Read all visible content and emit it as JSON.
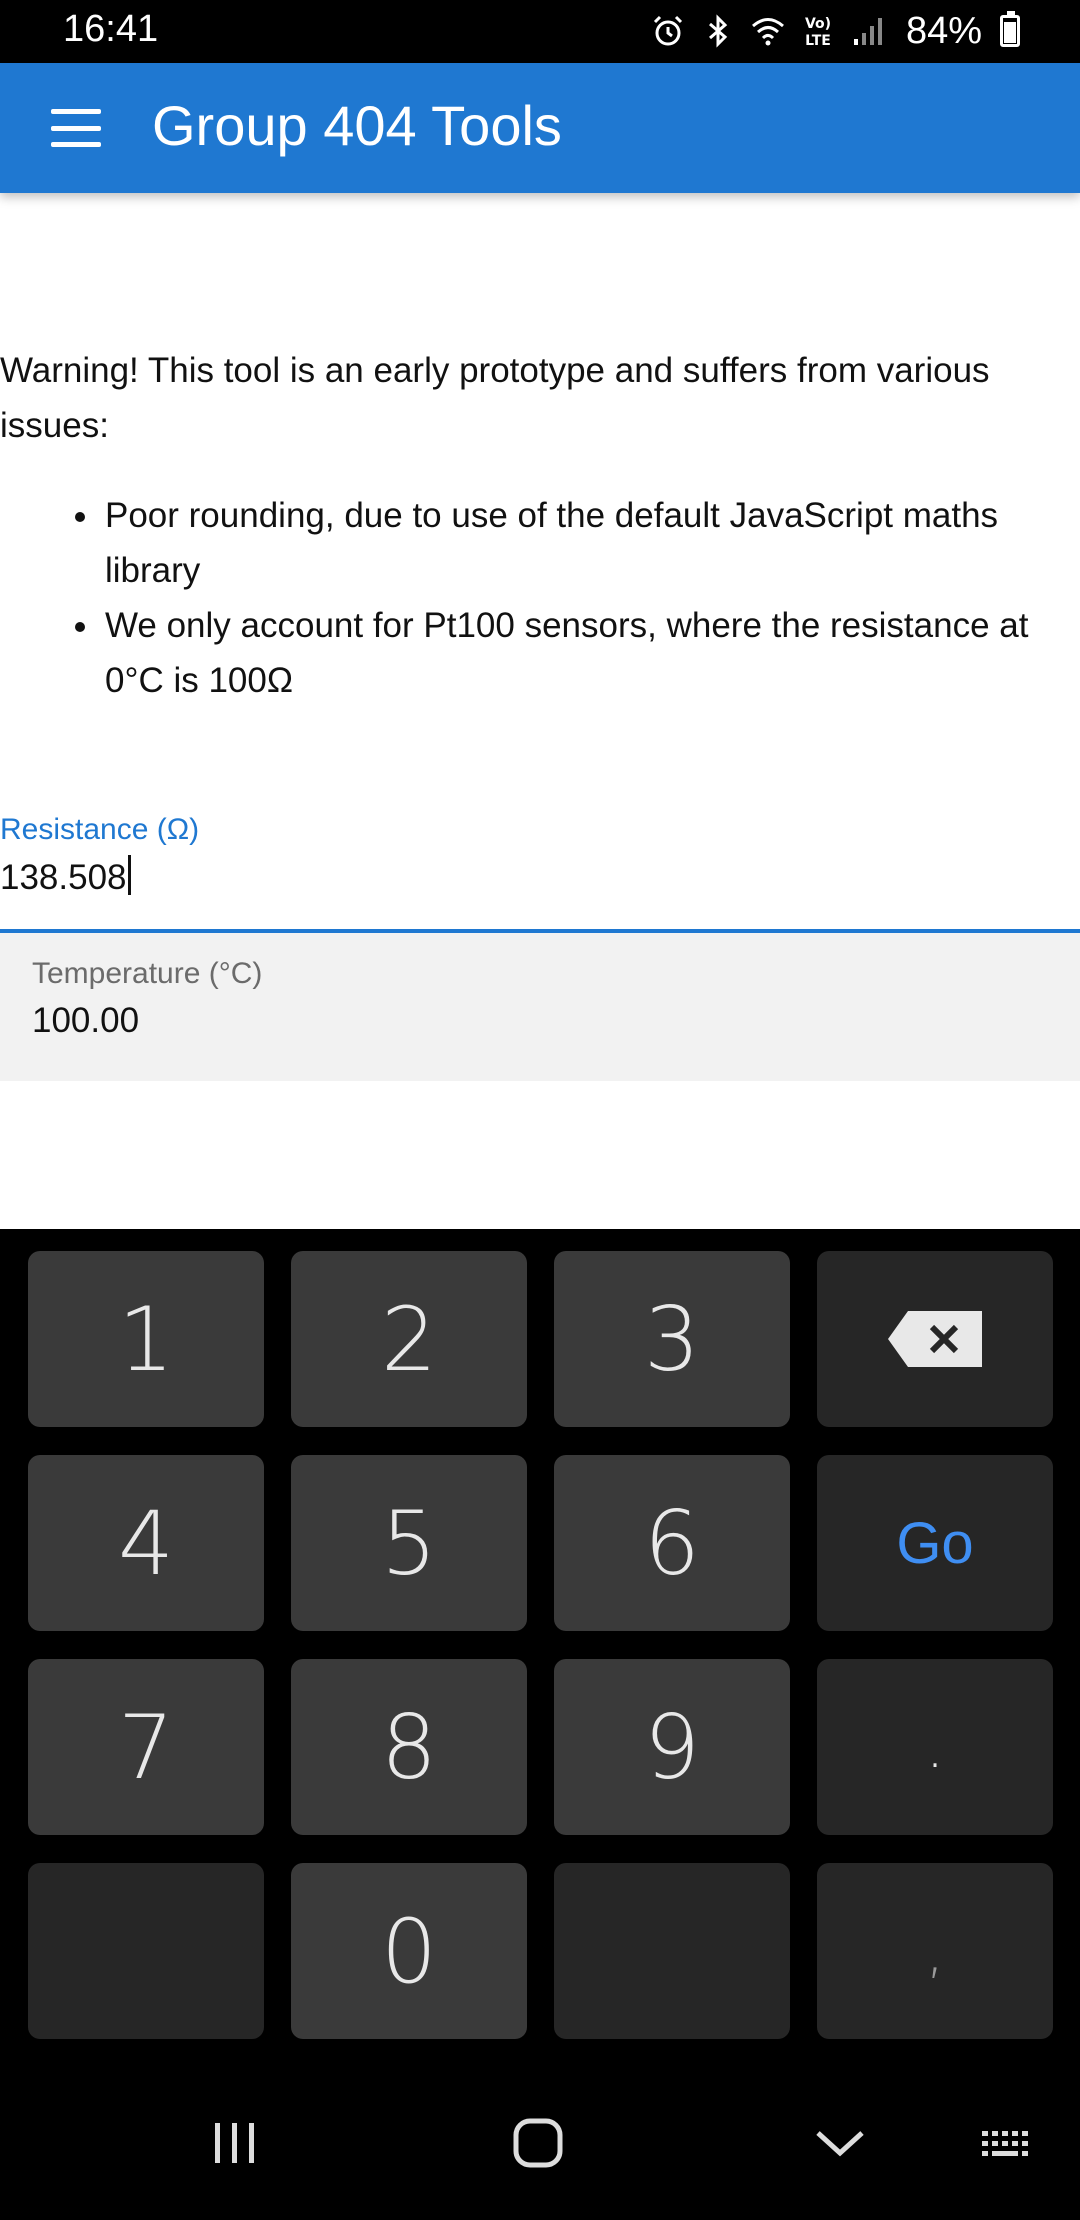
{
  "status_bar": {
    "time": "16:41",
    "battery": "84%",
    "icons": [
      "alarm-icon",
      "bluetooth-icon",
      "wifi-icon",
      "volte-icon",
      "signal-icon",
      "battery-icon"
    ],
    "volte_label": "Vo) LTE"
  },
  "app_bar": {
    "title": "Group 404 Tools",
    "menu_icon": "hamburger-menu-icon",
    "color": "#1f78d1"
  },
  "content": {
    "warning": "Warning! This tool is an early prototype and suffers from various issues:",
    "issues": [
      "Poor rounding, due to use of the default JavaScript maths library",
      "We only account for Pt100 sensors, where the resistance at 0°C is 100Ω"
    ],
    "resistance": {
      "label": "Resistance (Ω)",
      "value": "138.508"
    },
    "temperature": {
      "label": "Temperature (°C)",
      "value": "100.00"
    }
  },
  "keyboard": {
    "keys": [
      "1",
      "2",
      "3",
      "4",
      "5",
      "6",
      "7",
      "8",
      "9",
      "0",
      ".",
      ","
    ],
    "go_label": "Go",
    "backspace_icon": "backspace-icon",
    "accent": "#3f8ef2"
  },
  "nav_bar": {
    "icons": [
      "recent-apps-icon",
      "home-icon",
      "back-icon",
      "keyboard-switch-icon"
    ]
  }
}
